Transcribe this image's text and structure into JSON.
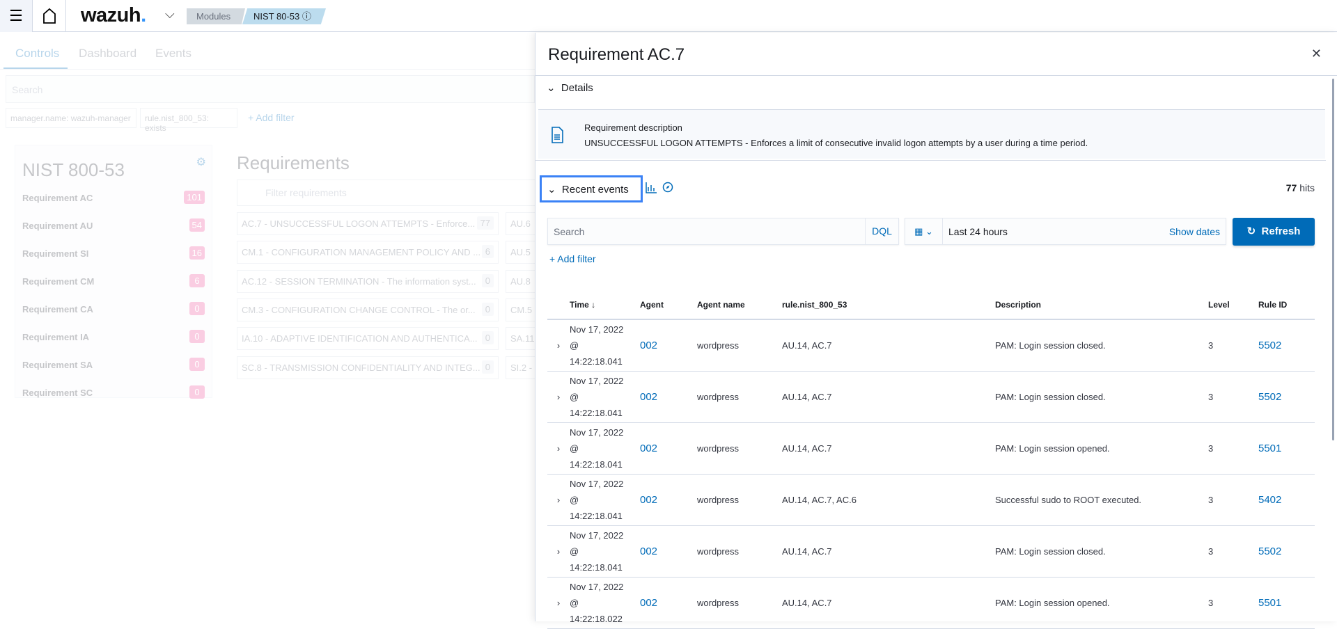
{
  "topbar": {
    "menu_icon": "hamburger-icon",
    "home_icon": "home-icon",
    "logo": "wazuh",
    "logo_dot": ".",
    "breadcrumbs": [
      "Modules",
      "NIST 80-53"
    ],
    "info_icon": "ⓘ"
  },
  "left": {
    "tabs": [
      "Controls",
      "Dashboard",
      "Events"
    ],
    "search_placeholder": "Search",
    "filters": [
      "manager.name: wazuh-manager",
      "rule.nist_800_53: exists"
    ],
    "add_filter": "+ Add filter",
    "nav_title": "NIST 800-53",
    "nav_items": [
      {
        "label": "Requirement AC",
        "count": "101"
      },
      {
        "label": "Requirement AU",
        "count": "54"
      },
      {
        "label": "Requirement SI",
        "count": "16"
      },
      {
        "label": "Requirement CM",
        "count": "6"
      },
      {
        "label": "Requirement CA",
        "count": "0"
      },
      {
        "label": "Requirement IA",
        "count": "0"
      },
      {
        "label": "Requirement SA",
        "count": "0"
      },
      {
        "label": "Requirement SC",
        "count": "0"
      }
    ],
    "requirements_title": "Requirements",
    "filter_placeholder": "Filter requirements",
    "cards": [
      {
        "label": "AC.7 - UNSUCCESSFUL LOGON ATTEMPTS - Enforce...",
        "count": "77"
      },
      {
        "label": "CM.1 - CONFIGURATION MANAGEMENT POLICY AND ...",
        "count": "6"
      },
      {
        "label": "AC.12 - SESSION TERMINATION - The information syst...",
        "count": "0"
      },
      {
        "label": "CM.3 - CONFIGURATION CHANGE CONTROL - The or...",
        "count": "0"
      },
      {
        "label": "IA.10 - ADAPTIVE IDENTIFICATION AND AUTHENTICA...",
        "count": "0"
      },
      {
        "label": "SC.8 - TRANSMISSION CONFIDENTIALITY AND INTEG...",
        "count": "0"
      }
    ],
    "cards2": [
      "AU.6",
      "AU.5",
      "AU.8",
      "CM.5",
      "SA.11",
      "SI.2 -"
    ]
  },
  "panel": {
    "title": "Requirement AC.7",
    "details_label": "Details",
    "desc_title": "Requirement description",
    "desc_text": "UNSUCCESSFUL LOGON ATTEMPTS - Enforces a limit of consecutive invalid logon attempts by a user during a time period.",
    "recent_label": "Recent events",
    "hits_count": "77",
    "hits_label": "hits",
    "search_placeholder": "Search",
    "dql": "DQL",
    "time_range": "Last 24 hours",
    "show_dates": "Show dates",
    "refresh": "Refresh",
    "add_filter": "+ Add filter",
    "columns": [
      "Time ↓",
      "Agent",
      "Agent name",
      "rule.nist_800_53",
      "Description",
      "Level",
      "Rule ID"
    ],
    "rows": [
      {
        "date": "Nov 17, 2022",
        "at": "@",
        "time": "14:22:18.041",
        "agent": "002",
        "agent_name": "wordpress",
        "rule": "AU.14, AC.7",
        "description": "PAM: Login session closed.",
        "level": "3",
        "rule_id": "5502"
      },
      {
        "date": "Nov 17, 2022",
        "at": "@",
        "time": "14:22:18.041",
        "agent": "002",
        "agent_name": "wordpress",
        "rule": "AU.14, AC.7",
        "description": "PAM: Login session closed.",
        "level": "3",
        "rule_id": "5502"
      },
      {
        "date": "Nov 17, 2022",
        "at": "@",
        "time": "14:22:18.041",
        "agent": "002",
        "agent_name": "wordpress",
        "rule": "AU.14, AC.7",
        "description": "PAM: Login session opened.",
        "level": "3",
        "rule_id": "5501"
      },
      {
        "date": "Nov 17, 2022",
        "at": "@",
        "time": "14:22:18.041",
        "agent": "002",
        "agent_name": "wordpress",
        "rule": "AU.14, AC.7, AC.6",
        "description": "Successful sudo to ROOT executed.",
        "level": "3",
        "rule_id": "5402"
      },
      {
        "date": "Nov 17, 2022",
        "at": "@",
        "time": "14:22:18.041",
        "agent": "002",
        "agent_name": "wordpress",
        "rule": "AU.14, AC.7",
        "description": "PAM: Login session closed.",
        "level": "3",
        "rule_id": "5502"
      },
      {
        "date": "Nov 17, 2022",
        "at": "@",
        "time": "14:22:18.022",
        "agent": "002",
        "agent_name": "wordpress",
        "rule": "AU.14, AC.7",
        "description": "PAM: Login session opened.",
        "level": "3",
        "rule_id": "5501"
      }
    ]
  }
}
